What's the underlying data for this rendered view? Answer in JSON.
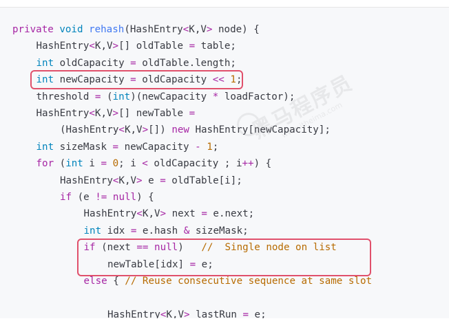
{
  "code": {
    "lines": [
      {
        "indent": 0,
        "tokens": [
          {
            "t": "private",
            "c": "kw"
          },
          {
            "t": " ",
            "c": "plain"
          },
          {
            "t": "void",
            "c": "type"
          },
          {
            "t": " ",
            "c": "plain"
          },
          {
            "t": "rehash",
            "c": "fn"
          },
          {
            "t": "(HashEntry",
            "c": "plain"
          },
          {
            "t": "<",
            "c": "op"
          },
          {
            "t": "K,V",
            "c": "plain"
          },
          {
            "t": ">",
            "c": "op"
          },
          {
            "t": " node) {",
            "c": "plain"
          }
        ]
      },
      {
        "indent": 1,
        "tokens": [
          {
            "t": "HashEntry",
            "c": "plain"
          },
          {
            "t": "<",
            "c": "op"
          },
          {
            "t": "K,V",
            "c": "plain"
          },
          {
            "t": ">",
            "c": "op"
          },
          {
            "t": "[] oldTable ",
            "c": "plain"
          },
          {
            "t": "=",
            "c": "op"
          },
          {
            "t": " table;",
            "c": "plain"
          }
        ]
      },
      {
        "indent": 1,
        "tokens": [
          {
            "t": "int",
            "c": "type"
          },
          {
            "t": " oldCapacity ",
            "c": "plain"
          },
          {
            "t": "=",
            "c": "op"
          },
          {
            "t": " oldTable.length;",
            "c": "plain"
          }
        ]
      },
      {
        "indent": 1,
        "tokens": [
          {
            "t": "int",
            "c": "type"
          },
          {
            "t": " newCapacity ",
            "c": "plain"
          },
          {
            "t": "=",
            "c": "op"
          },
          {
            "t": " oldCapacity ",
            "c": "plain"
          },
          {
            "t": "<<",
            "c": "op"
          },
          {
            "t": " ",
            "c": "plain"
          },
          {
            "t": "1",
            "c": "num"
          },
          {
            "t": ";",
            "c": "plain"
          }
        ]
      },
      {
        "indent": 1,
        "tokens": [
          {
            "t": "threshold ",
            "c": "plain"
          },
          {
            "t": "=",
            "c": "op"
          },
          {
            "t": " (",
            "c": "plain"
          },
          {
            "t": "int",
            "c": "type"
          },
          {
            "t": ")(newCapacity ",
            "c": "plain"
          },
          {
            "t": "*",
            "c": "op"
          },
          {
            "t": " loadFactor);",
            "c": "plain"
          }
        ]
      },
      {
        "indent": 1,
        "tokens": [
          {
            "t": "HashEntry",
            "c": "plain"
          },
          {
            "t": "<",
            "c": "op"
          },
          {
            "t": "K,V",
            "c": "plain"
          },
          {
            "t": ">",
            "c": "op"
          },
          {
            "t": "[] newTable ",
            "c": "plain"
          },
          {
            "t": "=",
            "c": "op"
          }
        ]
      },
      {
        "indent": 2,
        "tokens": [
          {
            "t": "(HashEntry",
            "c": "plain"
          },
          {
            "t": "<",
            "c": "op"
          },
          {
            "t": "K,V",
            "c": "plain"
          },
          {
            "t": ">",
            "c": "op"
          },
          {
            "t": "[]) ",
            "c": "plain"
          },
          {
            "t": "new",
            "c": "kw"
          },
          {
            "t": " HashEntry[newCapacity];",
            "c": "plain"
          }
        ]
      },
      {
        "indent": 1,
        "tokens": [
          {
            "t": "int",
            "c": "type"
          },
          {
            "t": " sizeMask ",
            "c": "plain"
          },
          {
            "t": "=",
            "c": "op"
          },
          {
            "t": " newCapacity ",
            "c": "plain"
          },
          {
            "t": "-",
            "c": "op"
          },
          {
            "t": " ",
            "c": "plain"
          },
          {
            "t": "1",
            "c": "num"
          },
          {
            "t": ";",
            "c": "plain"
          }
        ]
      },
      {
        "indent": 1,
        "tokens": [
          {
            "t": "for",
            "c": "kw"
          },
          {
            "t": " (",
            "c": "plain"
          },
          {
            "t": "int",
            "c": "type"
          },
          {
            "t": " i ",
            "c": "plain"
          },
          {
            "t": "=",
            "c": "op"
          },
          {
            "t": " ",
            "c": "plain"
          },
          {
            "t": "0",
            "c": "num"
          },
          {
            "t": "; i ",
            "c": "plain"
          },
          {
            "t": "<",
            "c": "op"
          },
          {
            "t": " oldCapacity ; i",
            "c": "plain"
          },
          {
            "t": "++",
            "c": "op"
          },
          {
            "t": ") {",
            "c": "plain"
          }
        ]
      },
      {
        "indent": 2,
        "tokens": [
          {
            "t": "HashEntry",
            "c": "plain"
          },
          {
            "t": "<",
            "c": "op"
          },
          {
            "t": "K,V",
            "c": "plain"
          },
          {
            "t": ">",
            "c": "op"
          },
          {
            "t": " e ",
            "c": "plain"
          },
          {
            "t": "=",
            "c": "op"
          },
          {
            "t": " oldTable[i];",
            "c": "plain"
          }
        ]
      },
      {
        "indent": 2,
        "tokens": [
          {
            "t": "if",
            "c": "kw"
          },
          {
            "t": " (e ",
            "c": "plain"
          },
          {
            "t": "!=",
            "c": "op"
          },
          {
            "t": " ",
            "c": "plain"
          },
          {
            "t": "null",
            "c": "kw"
          },
          {
            "t": ") {",
            "c": "plain"
          }
        ]
      },
      {
        "indent": 3,
        "tokens": [
          {
            "t": "HashEntry",
            "c": "plain"
          },
          {
            "t": "<",
            "c": "op"
          },
          {
            "t": "K,V",
            "c": "plain"
          },
          {
            "t": ">",
            "c": "op"
          },
          {
            "t": " next ",
            "c": "plain"
          },
          {
            "t": "=",
            "c": "op"
          },
          {
            "t": " e.next;",
            "c": "plain"
          }
        ]
      },
      {
        "indent": 3,
        "tokens": [
          {
            "t": "int",
            "c": "type"
          },
          {
            "t": " idx ",
            "c": "plain"
          },
          {
            "t": "=",
            "c": "op"
          },
          {
            "t": " e.hash ",
            "c": "plain"
          },
          {
            "t": "&",
            "c": "op"
          },
          {
            "t": " sizeMask;",
            "c": "plain"
          }
        ]
      },
      {
        "indent": 3,
        "tokens": [
          {
            "t": "if",
            "c": "kw"
          },
          {
            "t": " (next ",
            "c": "plain"
          },
          {
            "t": "==",
            "c": "op"
          },
          {
            "t": " ",
            "c": "plain"
          },
          {
            "t": "null",
            "c": "kw"
          },
          {
            "t": ")   ",
            "c": "plain"
          },
          {
            "t": "//  Single node on list",
            "c": "comment2"
          }
        ]
      },
      {
        "indent": 4,
        "tokens": [
          {
            "t": "newTable[idx] ",
            "c": "plain"
          },
          {
            "t": "=",
            "c": "op"
          },
          {
            "t": " e;",
            "c": "plain"
          }
        ]
      },
      {
        "indent": 3,
        "tokens": [
          {
            "t": "else",
            "c": "kw"
          },
          {
            "t": " { ",
            "c": "plain"
          },
          {
            "t": "// Reuse consecutive sequence at same slot",
            "c": "comment2"
          }
        ]
      },
      {
        "indent": 3,
        "tokens": []
      },
      {
        "indent": 4,
        "tokens": [
          {
            "t": "HashEntry",
            "c": "plain"
          },
          {
            "t": "<",
            "c": "op"
          },
          {
            "t": "K,V",
            "c": "plain"
          },
          {
            "t": ">",
            "c": "op"
          },
          {
            "t": " lastRun ",
            "c": "plain"
          },
          {
            "t": "=",
            "c": "op"
          },
          {
            "t": " e;",
            "c": "plain"
          }
        ]
      }
    ]
  },
  "watermark": {
    "brand": "黑马程序员",
    "site": "www.itheima.com"
  },
  "colors": {
    "highlight_border": "#e0506b",
    "panel_background": "#f7f8fa",
    "keyword": "#a626a4",
    "type": "#0184bc",
    "function": "#4078f2",
    "number": "#b76b01",
    "comment": "#b76b01"
  }
}
